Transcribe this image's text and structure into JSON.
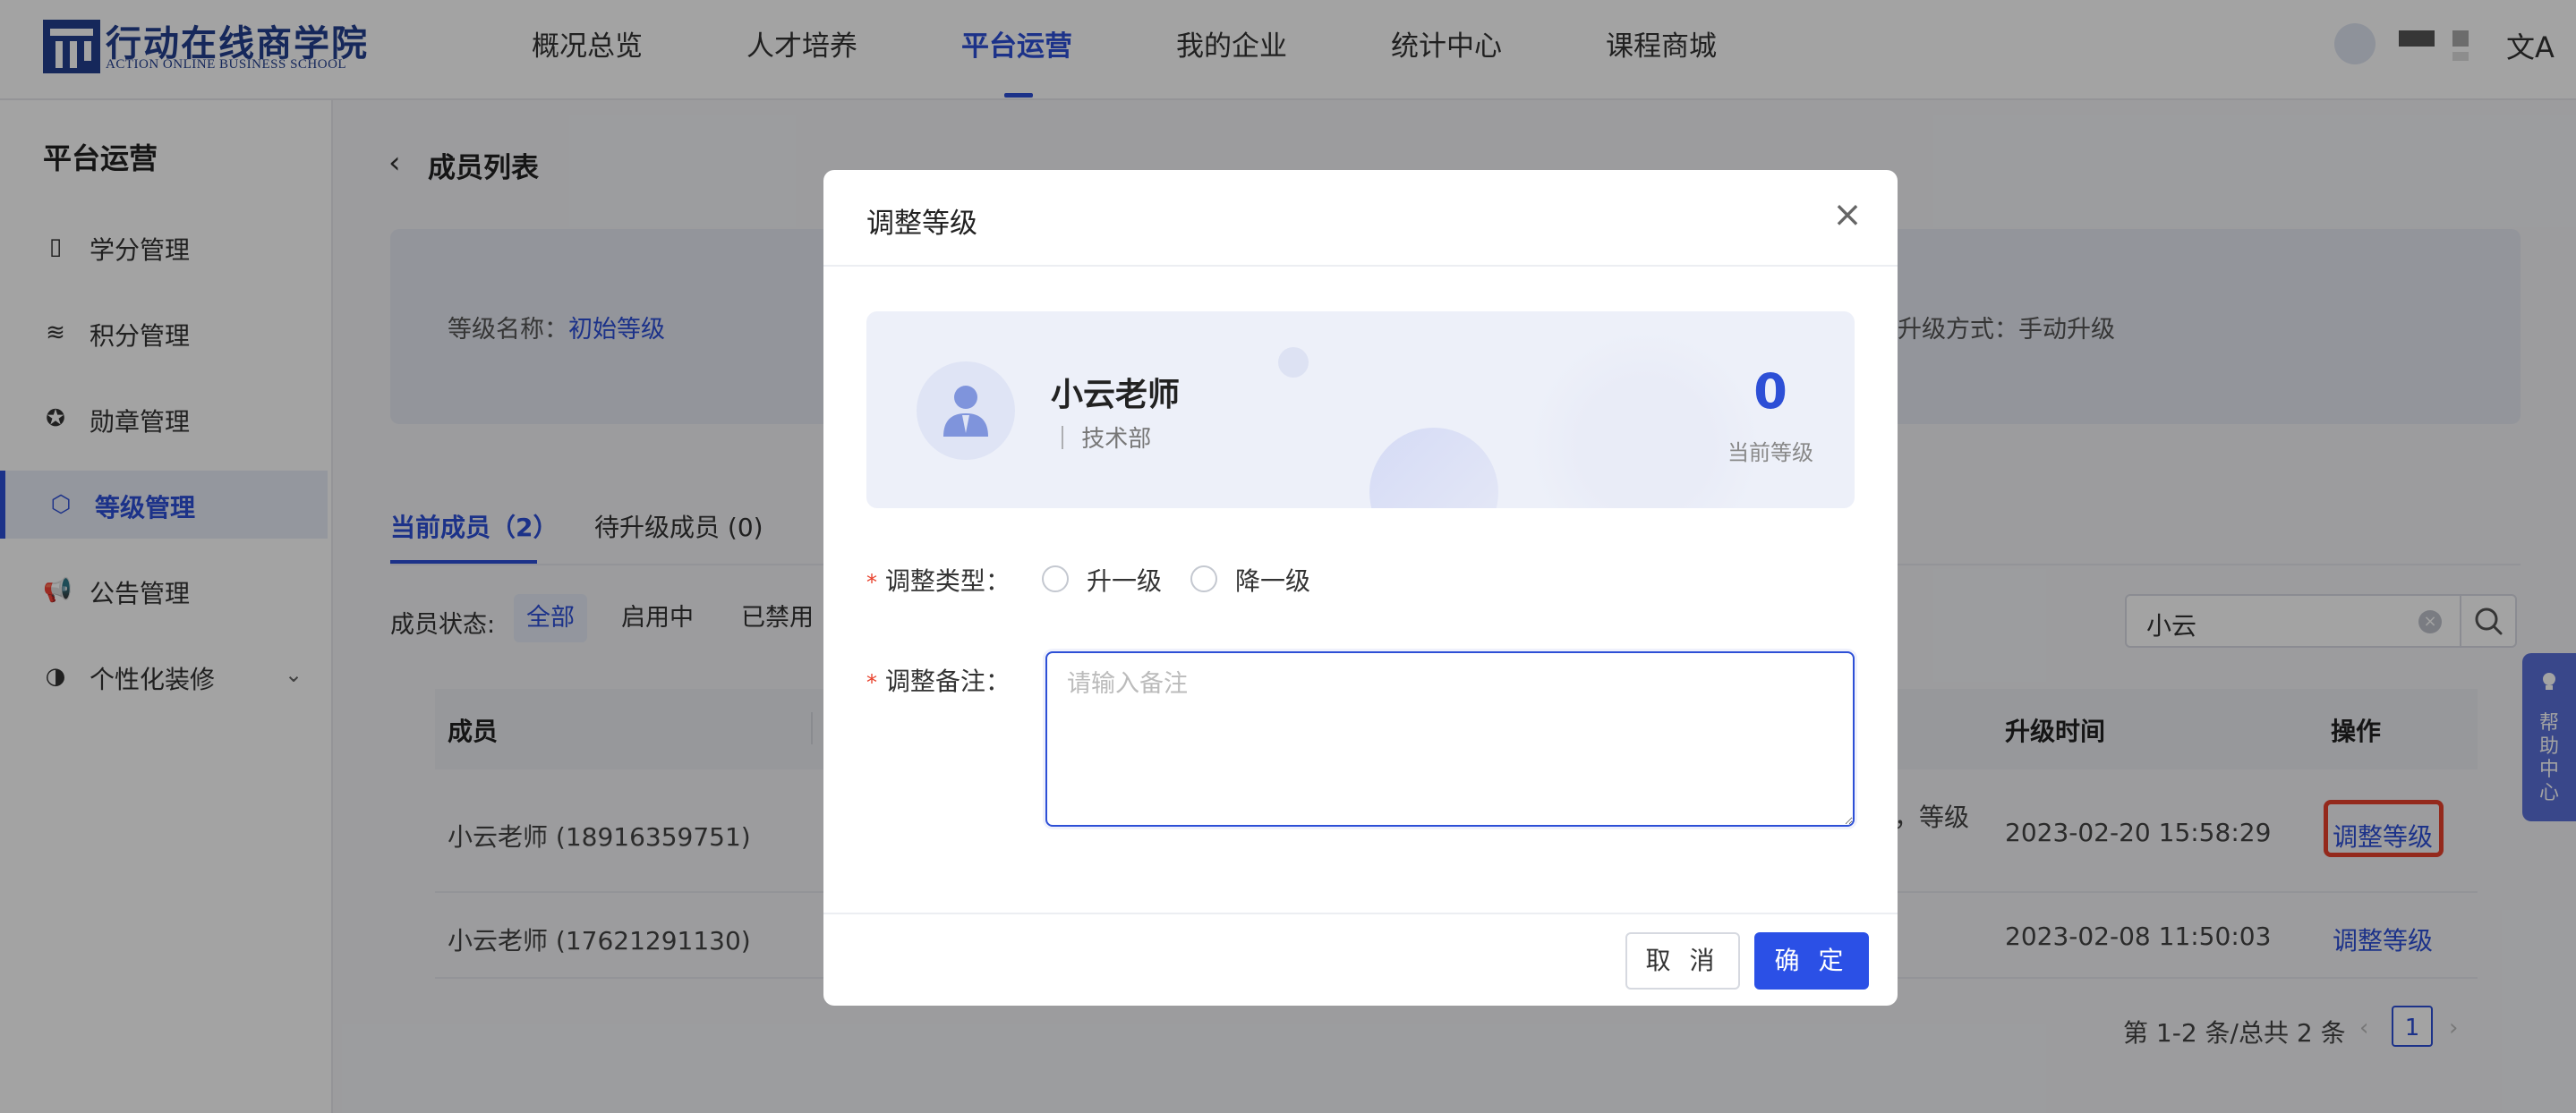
{
  "header": {
    "logo_cn": "行动在线商学院",
    "logo_en": "ACTION ONLINE BUSINESS SCHOOL",
    "nav": [
      {
        "label": "概况总览",
        "active": false
      },
      {
        "label": "人才培养",
        "active": false
      },
      {
        "label": "平台运营",
        "active": true
      },
      {
        "label": "我的企业",
        "active": false
      },
      {
        "label": "统计中心",
        "active": false
      },
      {
        "label": "课程商城",
        "active": false
      }
    ],
    "lang_icon": "文A"
  },
  "sidebar": {
    "title": "平台运营",
    "items": [
      {
        "label": "学分管理",
        "icon": "book-icon",
        "glyph": "▯",
        "active": false
      },
      {
        "label": "积分管理",
        "icon": "database-icon",
        "glyph": "≋",
        "active": false
      },
      {
        "label": "勋章管理",
        "icon": "medal-icon",
        "glyph": "✪",
        "active": false
      },
      {
        "label": "等级管理",
        "icon": "level-icon",
        "glyph": "⬡",
        "active": true
      },
      {
        "label": "公告管理",
        "icon": "megaphone-icon",
        "glyph": "📢",
        "active": false
      },
      {
        "label": "个性化装修",
        "icon": "palette-icon",
        "glyph": "◑",
        "active": false,
        "expandable": true
      }
    ]
  },
  "main": {
    "back_icon": "‹",
    "page_title": "成员列表",
    "info": {
      "level_name_label": "等级名称：",
      "level_name_value": "初始等级",
      "upgrade_method_label": "升级方式：",
      "upgrade_method_value": "手动升级"
    },
    "tabs": [
      {
        "label": "当前成员（2）",
        "active": true
      },
      {
        "label": "待升级成员 (0)",
        "active": false
      }
    ],
    "filter": {
      "label": "成员状态:",
      "options": [
        {
          "label": "全部",
          "active": true
        },
        {
          "label": "启用中",
          "active": false
        },
        {
          "label": "已禁用",
          "active": false
        }
      ]
    },
    "search": {
      "value": "小云",
      "clear": "×"
    },
    "table": {
      "columns": [
        "成员",
        "升级时间",
        "操作"
      ],
      "rows": [
        {
          "member": "小云老师 (18916359751)",
          "partial": "，等级",
          "time": "2023-02-20 15:58:29",
          "action": "调整等级"
        },
        {
          "member": "小云老师 (17621291130)",
          "partial": "",
          "time": "2023-02-08 11:50:03",
          "action": "调整等级"
        }
      ]
    },
    "pagination": {
      "summary": "第 1-2 条/总共 2 条",
      "current": "1",
      "prev": "‹",
      "next": "›"
    }
  },
  "help": {
    "label": "帮助中心",
    "chars": [
      "帮",
      "助",
      "中",
      "心"
    ]
  },
  "modal": {
    "title": "调整等级",
    "close": "×",
    "profile": {
      "name": "小云老师",
      "dept": "｜ 技术部",
      "level": "0",
      "level_label": "当前等级"
    },
    "form": {
      "required_mark": "*",
      "type_label": "调整类型：",
      "options": [
        "升一级",
        "降一级"
      ],
      "note_label": "调整备注：",
      "note_placeholder": "请输入备注",
      "note_value": ""
    },
    "buttons": {
      "cancel": "取 消",
      "ok": "确 定"
    }
  },
  "colors": {
    "primary": "#2d4fd6",
    "danger": "#e8412c",
    "brand": "#233f8f"
  }
}
